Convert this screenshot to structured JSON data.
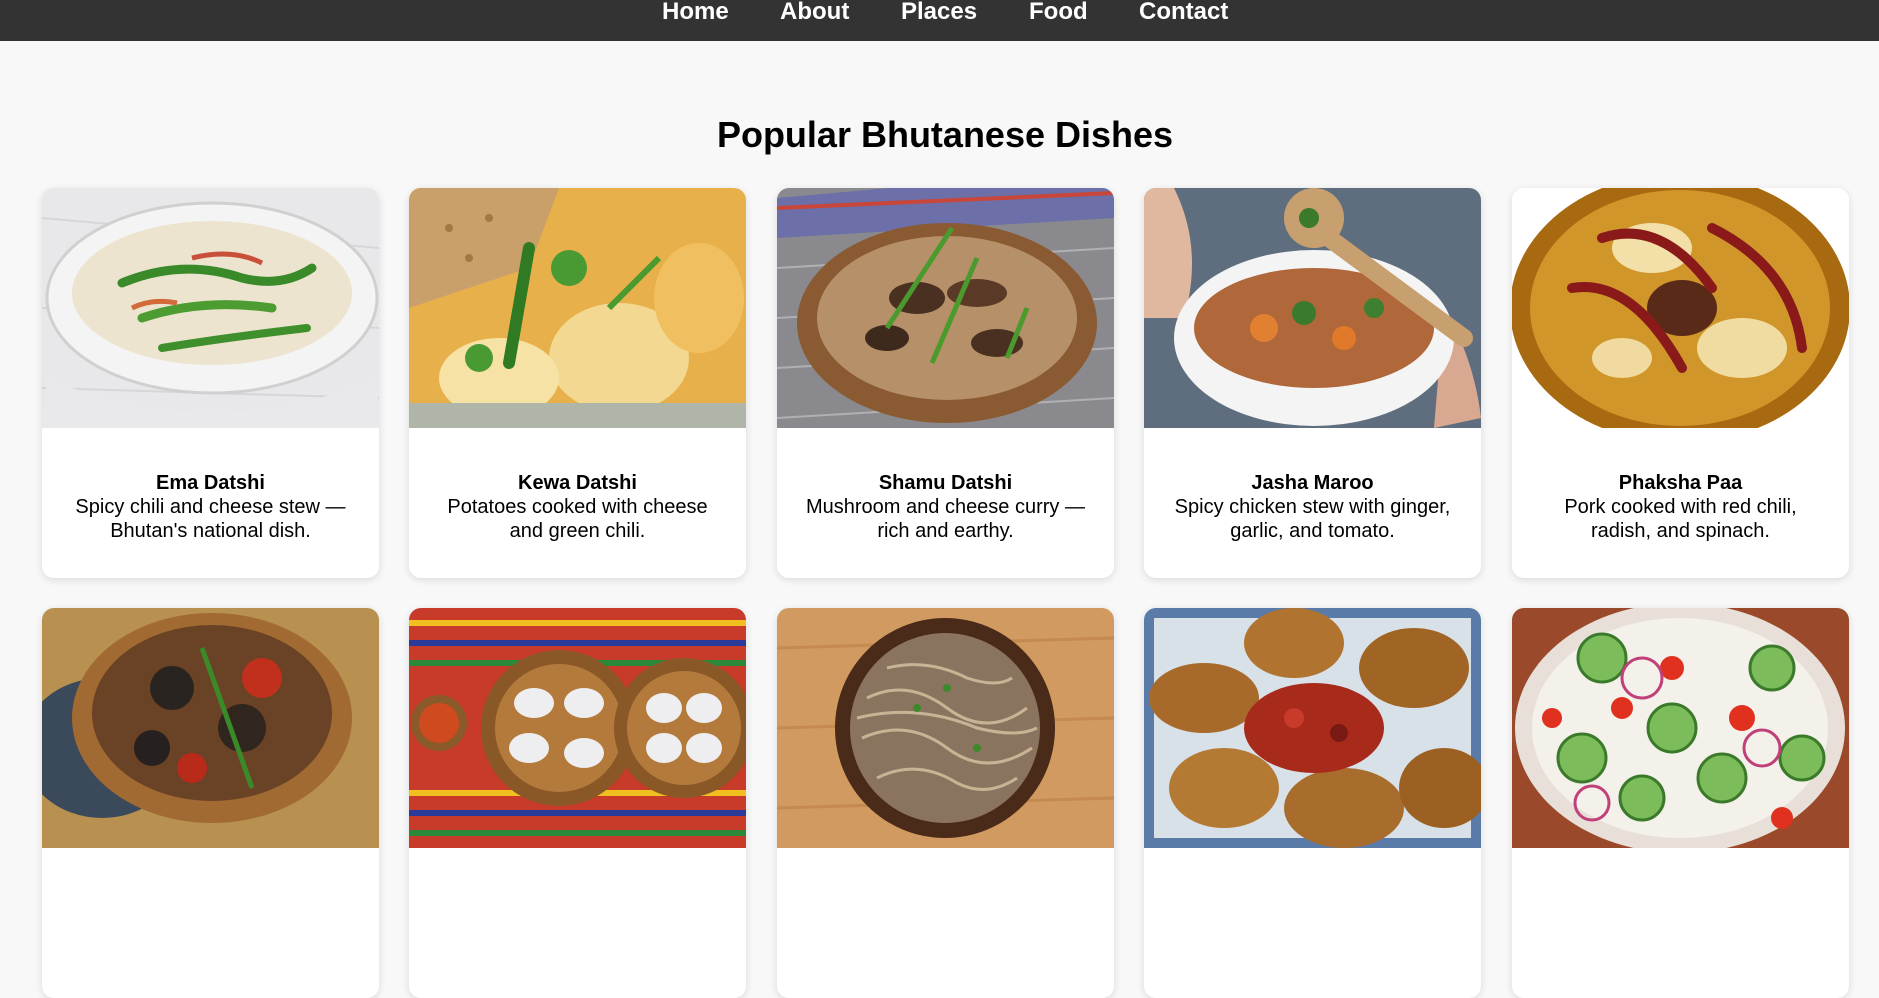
{
  "nav": {
    "items": [
      {
        "label": "Home"
      },
      {
        "label": "About"
      },
      {
        "label": "Places"
      },
      {
        "label": "Food"
      },
      {
        "label": "Contact"
      }
    ],
    "background": "#333333",
    "text_color": "#ffffff"
  },
  "page": {
    "title": "Popular Bhutanese Dishes",
    "background": "#f8f8f8"
  },
  "dishes": [
    {
      "name": "Ema Datshi",
      "description": "Spicy chili and cheese stew — Bhutan's national dish.",
      "image": "chili-cheese-stew-bowl"
    },
    {
      "name": "Kewa Datshi",
      "description": "Potatoes cooked with cheese and green chili.",
      "image": "potato-cheese-curry-with-rice"
    },
    {
      "name": "Shamu Datshi",
      "description": "Mushroom and cheese curry — rich and earthy.",
      "image": "mushroom-cheese-curry-bowl"
    },
    {
      "name": "Jasha Maroo",
      "description": "Spicy chicken stew with ginger, garlic, and tomato.",
      "image": "chicken-stew-with-spoon"
    },
    {
      "name": "Phaksha Paa",
      "description": "Pork cooked with red chili, radish, and spinach.",
      "image": "pork-red-chili-radish-plate"
    },
    {
      "name": "",
      "description": "",
      "image": "stir-fried-meat-wooden-bowl"
    },
    {
      "name": "",
      "description": "",
      "image": "momo-dumplings-two-bowls"
    },
    {
      "name": "",
      "description": "",
      "image": "buckwheat-noodles-bowl"
    },
    {
      "name": "",
      "description": "",
      "image": "fried-dumplings-with-chili"
    },
    {
      "name": "",
      "description": "",
      "image": "cucumber-tomato-onion-salad"
    }
  ]
}
